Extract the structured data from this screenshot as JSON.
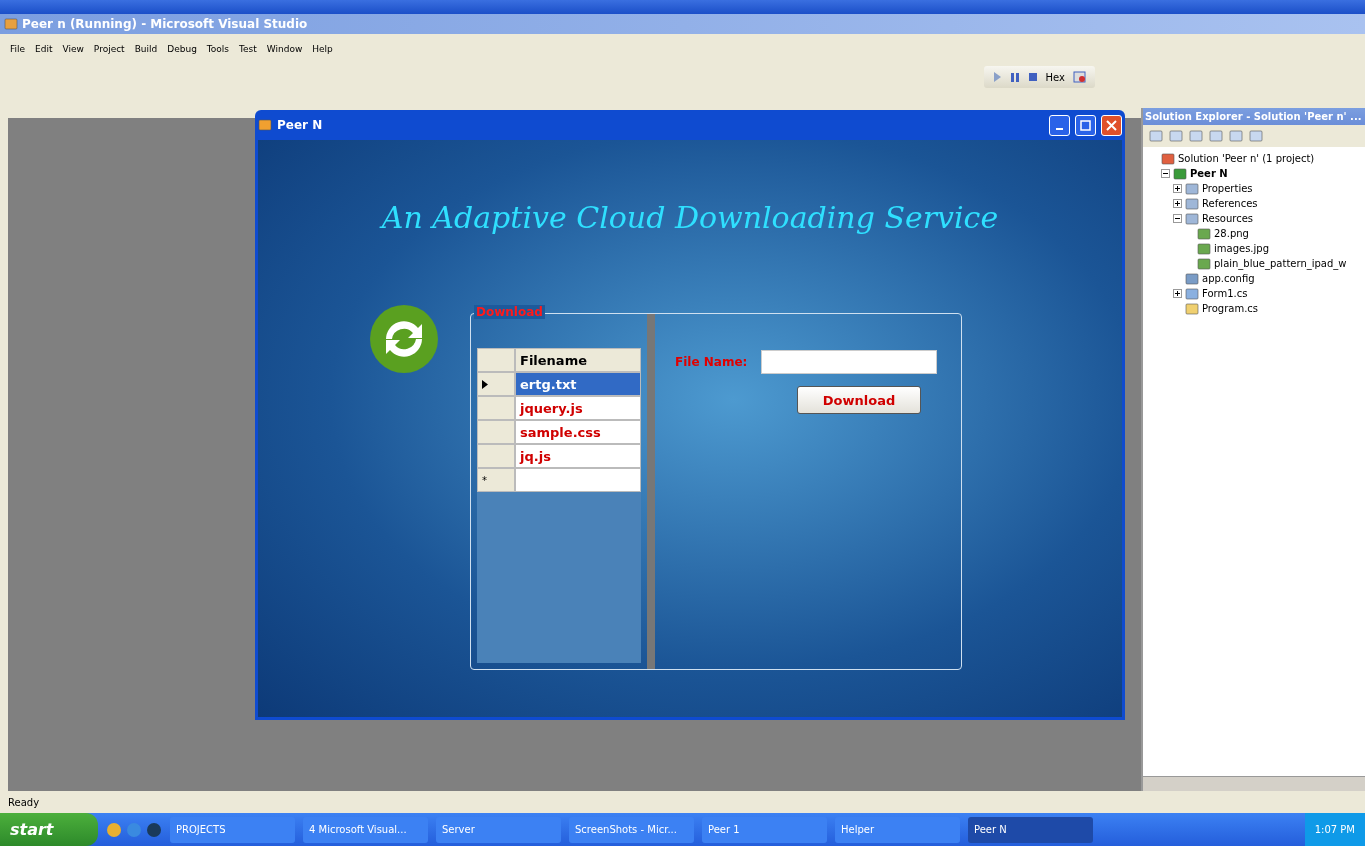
{
  "window": {
    "title": "Peer n (Running) - Microsoft Visual Studio"
  },
  "menu": [
    "File",
    "Edit",
    "View",
    "Project",
    "Build",
    "Debug",
    "Tools",
    "Test",
    "Window",
    "Help"
  ],
  "debug_toolbar": {
    "hex_label": "Hex"
  },
  "form": {
    "title": "Peer N",
    "heading": "An Adaptive Cloud Downloading Service",
    "group_label": "Download",
    "grid": {
      "column": "Filename",
      "rows": [
        {
          "name": "ertg.txt",
          "selected": true
        },
        {
          "name": "jquery.js",
          "selected": false
        },
        {
          "name": "sample.css",
          "selected": false
        },
        {
          "name": "jq.js",
          "selected": false
        }
      ],
      "new_row_marker": "*"
    },
    "file_label": "File Name:",
    "button": "Download"
  },
  "solution_explorer": {
    "title": "Solution Explorer - Solution 'Peer n' ...",
    "tree": [
      {
        "label": "Solution 'Peer n' (1 project)",
        "kind": "solution",
        "children": [
          {
            "label": "Peer N",
            "kind": "project",
            "expanded": true,
            "children": [
              {
                "label": "Properties",
                "kind": "folder",
                "expanded": false
              },
              {
                "label": "References",
                "kind": "folder",
                "expanded": false
              },
              {
                "label": "Resources",
                "kind": "folder",
                "expanded": true,
                "children": [
                  {
                    "label": "28.png",
                    "kind": "image"
                  },
                  {
                    "label": "images.jpg",
                    "kind": "image"
                  },
                  {
                    "label": "plain_blue_pattern_ipad_w",
                    "kind": "image"
                  }
                ]
              },
              {
                "label": "app.config",
                "kind": "file"
              },
              {
                "label": "Form1.cs",
                "kind": "form",
                "expanded": false
              },
              {
                "label": "Program.cs",
                "kind": "code"
              }
            ]
          }
        ]
      }
    ]
  },
  "status_bar": "Ready",
  "taskbar": {
    "start": "start",
    "tasks": [
      {
        "label": "PROJECTS",
        "selected": false
      },
      {
        "label": "4 Microsoft Visual...",
        "selected": false
      },
      {
        "label": "Server",
        "selected": false
      },
      {
        "label": "ScreenShots - Micr...",
        "selected": false
      },
      {
        "label": "Peer 1",
        "selected": false
      },
      {
        "label": "Helper",
        "selected": false
      },
      {
        "label": "Peer N",
        "selected": true
      }
    ],
    "clock": "1:07 PM"
  }
}
